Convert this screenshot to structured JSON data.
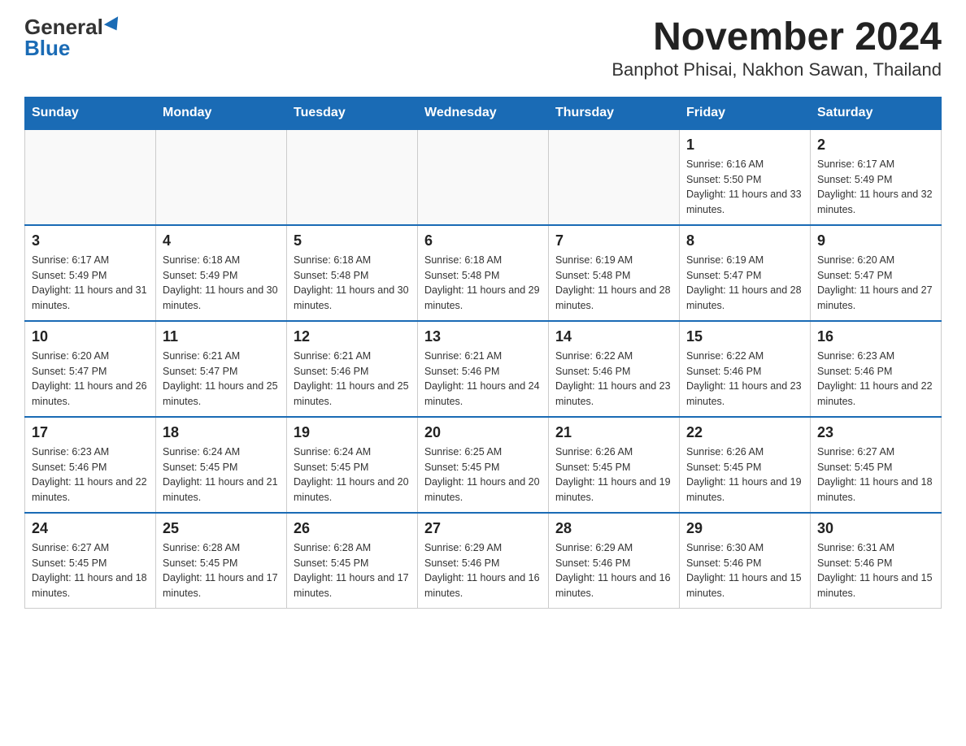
{
  "logo": {
    "general": "General",
    "blue": "Blue"
  },
  "title": "November 2024",
  "subtitle": "Banphot Phisai, Nakhon Sawan, Thailand",
  "days_of_week": [
    "Sunday",
    "Monday",
    "Tuesday",
    "Wednesday",
    "Thursday",
    "Friday",
    "Saturday"
  ],
  "weeks": [
    [
      {
        "day": "",
        "info": ""
      },
      {
        "day": "",
        "info": ""
      },
      {
        "day": "",
        "info": ""
      },
      {
        "day": "",
        "info": ""
      },
      {
        "day": "",
        "info": ""
      },
      {
        "day": "1",
        "info": "Sunrise: 6:16 AM\nSunset: 5:50 PM\nDaylight: 11 hours and 33 minutes."
      },
      {
        "day": "2",
        "info": "Sunrise: 6:17 AM\nSunset: 5:49 PM\nDaylight: 11 hours and 32 minutes."
      }
    ],
    [
      {
        "day": "3",
        "info": "Sunrise: 6:17 AM\nSunset: 5:49 PM\nDaylight: 11 hours and 31 minutes."
      },
      {
        "day": "4",
        "info": "Sunrise: 6:18 AM\nSunset: 5:49 PM\nDaylight: 11 hours and 30 minutes."
      },
      {
        "day": "5",
        "info": "Sunrise: 6:18 AM\nSunset: 5:48 PM\nDaylight: 11 hours and 30 minutes."
      },
      {
        "day": "6",
        "info": "Sunrise: 6:18 AM\nSunset: 5:48 PM\nDaylight: 11 hours and 29 minutes."
      },
      {
        "day": "7",
        "info": "Sunrise: 6:19 AM\nSunset: 5:48 PM\nDaylight: 11 hours and 28 minutes."
      },
      {
        "day": "8",
        "info": "Sunrise: 6:19 AM\nSunset: 5:47 PM\nDaylight: 11 hours and 28 minutes."
      },
      {
        "day": "9",
        "info": "Sunrise: 6:20 AM\nSunset: 5:47 PM\nDaylight: 11 hours and 27 minutes."
      }
    ],
    [
      {
        "day": "10",
        "info": "Sunrise: 6:20 AM\nSunset: 5:47 PM\nDaylight: 11 hours and 26 minutes."
      },
      {
        "day": "11",
        "info": "Sunrise: 6:21 AM\nSunset: 5:47 PM\nDaylight: 11 hours and 25 minutes."
      },
      {
        "day": "12",
        "info": "Sunrise: 6:21 AM\nSunset: 5:46 PM\nDaylight: 11 hours and 25 minutes."
      },
      {
        "day": "13",
        "info": "Sunrise: 6:21 AM\nSunset: 5:46 PM\nDaylight: 11 hours and 24 minutes."
      },
      {
        "day": "14",
        "info": "Sunrise: 6:22 AM\nSunset: 5:46 PM\nDaylight: 11 hours and 23 minutes."
      },
      {
        "day": "15",
        "info": "Sunrise: 6:22 AM\nSunset: 5:46 PM\nDaylight: 11 hours and 23 minutes."
      },
      {
        "day": "16",
        "info": "Sunrise: 6:23 AM\nSunset: 5:46 PM\nDaylight: 11 hours and 22 minutes."
      }
    ],
    [
      {
        "day": "17",
        "info": "Sunrise: 6:23 AM\nSunset: 5:46 PM\nDaylight: 11 hours and 22 minutes."
      },
      {
        "day": "18",
        "info": "Sunrise: 6:24 AM\nSunset: 5:45 PM\nDaylight: 11 hours and 21 minutes."
      },
      {
        "day": "19",
        "info": "Sunrise: 6:24 AM\nSunset: 5:45 PM\nDaylight: 11 hours and 20 minutes."
      },
      {
        "day": "20",
        "info": "Sunrise: 6:25 AM\nSunset: 5:45 PM\nDaylight: 11 hours and 20 minutes."
      },
      {
        "day": "21",
        "info": "Sunrise: 6:26 AM\nSunset: 5:45 PM\nDaylight: 11 hours and 19 minutes."
      },
      {
        "day": "22",
        "info": "Sunrise: 6:26 AM\nSunset: 5:45 PM\nDaylight: 11 hours and 19 minutes."
      },
      {
        "day": "23",
        "info": "Sunrise: 6:27 AM\nSunset: 5:45 PM\nDaylight: 11 hours and 18 minutes."
      }
    ],
    [
      {
        "day": "24",
        "info": "Sunrise: 6:27 AM\nSunset: 5:45 PM\nDaylight: 11 hours and 18 minutes."
      },
      {
        "day": "25",
        "info": "Sunrise: 6:28 AM\nSunset: 5:45 PM\nDaylight: 11 hours and 17 minutes."
      },
      {
        "day": "26",
        "info": "Sunrise: 6:28 AM\nSunset: 5:45 PM\nDaylight: 11 hours and 17 minutes."
      },
      {
        "day": "27",
        "info": "Sunrise: 6:29 AM\nSunset: 5:46 PM\nDaylight: 11 hours and 16 minutes."
      },
      {
        "day": "28",
        "info": "Sunrise: 6:29 AM\nSunset: 5:46 PM\nDaylight: 11 hours and 16 minutes."
      },
      {
        "day": "29",
        "info": "Sunrise: 6:30 AM\nSunset: 5:46 PM\nDaylight: 11 hours and 15 minutes."
      },
      {
        "day": "30",
        "info": "Sunrise: 6:31 AM\nSunset: 5:46 PM\nDaylight: 11 hours and 15 minutes."
      }
    ]
  ]
}
